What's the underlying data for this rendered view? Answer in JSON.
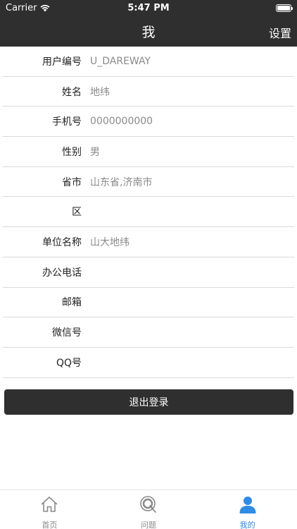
{
  "status_bar": {
    "carrier": "Carrier",
    "time": "5:47 PM"
  },
  "nav": {
    "title": "我",
    "right_label": "设置"
  },
  "profile_rows": [
    {
      "label": "用户编号",
      "value": "U_DAREWAY"
    },
    {
      "label": "姓名",
      "value": "地纬"
    },
    {
      "label": "手机号",
      "value": "0000000000"
    },
    {
      "label": "性别",
      "value": "男"
    },
    {
      "label": "省市",
      "value": "山东省,济南市"
    },
    {
      "label": "区",
      "value": ""
    },
    {
      "label": "单位名称",
      "value": "山大地纬"
    },
    {
      "label": "办公电话",
      "value": ""
    },
    {
      "label": "邮箱",
      "value": ""
    },
    {
      "label": "微信号",
      "value": ""
    },
    {
      "label": "QQ号",
      "value": ""
    }
  ],
  "logout_label": "退出登录",
  "tabs": [
    {
      "label": "首页",
      "icon": "home-icon",
      "active": false
    },
    {
      "label": "问题",
      "icon": "question-search-icon",
      "active": false
    },
    {
      "label": "我的",
      "icon": "user-icon",
      "active": true
    }
  ],
  "colors": {
    "bar": "#2f2f2f",
    "accent": "#2e8be6",
    "value_text": "#8a8a8a"
  }
}
